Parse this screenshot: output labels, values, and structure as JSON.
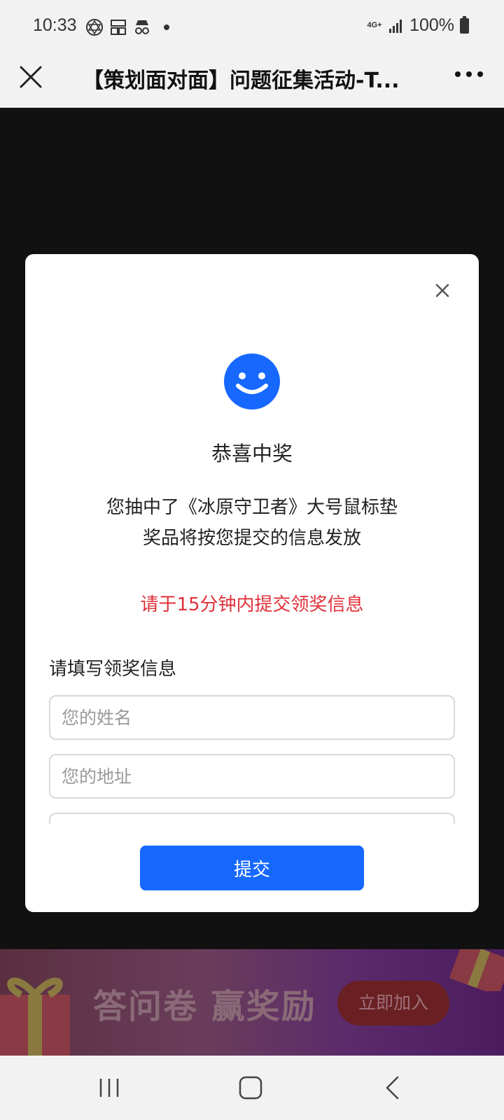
{
  "status_bar": {
    "time": "10:33",
    "network": "4G+",
    "battery": "100%"
  },
  "title_bar": {
    "title": "【策划面对面】问题征集活动-T..."
  },
  "modal": {
    "heading": "恭喜中奖",
    "message_line1": "您抽中了《冰原守卫者》大号鼠标垫",
    "message_line2": "奖品将按您提交的信息发放",
    "warning": "请于15分钟内提交领奖信息",
    "form_label": "请填写领奖信息",
    "fields": {
      "name_placeholder": "您的姓名",
      "address_placeholder": "您的地址",
      "phone_placeholder": ""
    },
    "submit_label": "提交"
  },
  "banner": {
    "text": "答问卷 赢奖励",
    "button_label": "立即加入"
  },
  "colors": {
    "accent": "#1668ff",
    "warning": "#e0303a",
    "smile": "#1668ff"
  }
}
